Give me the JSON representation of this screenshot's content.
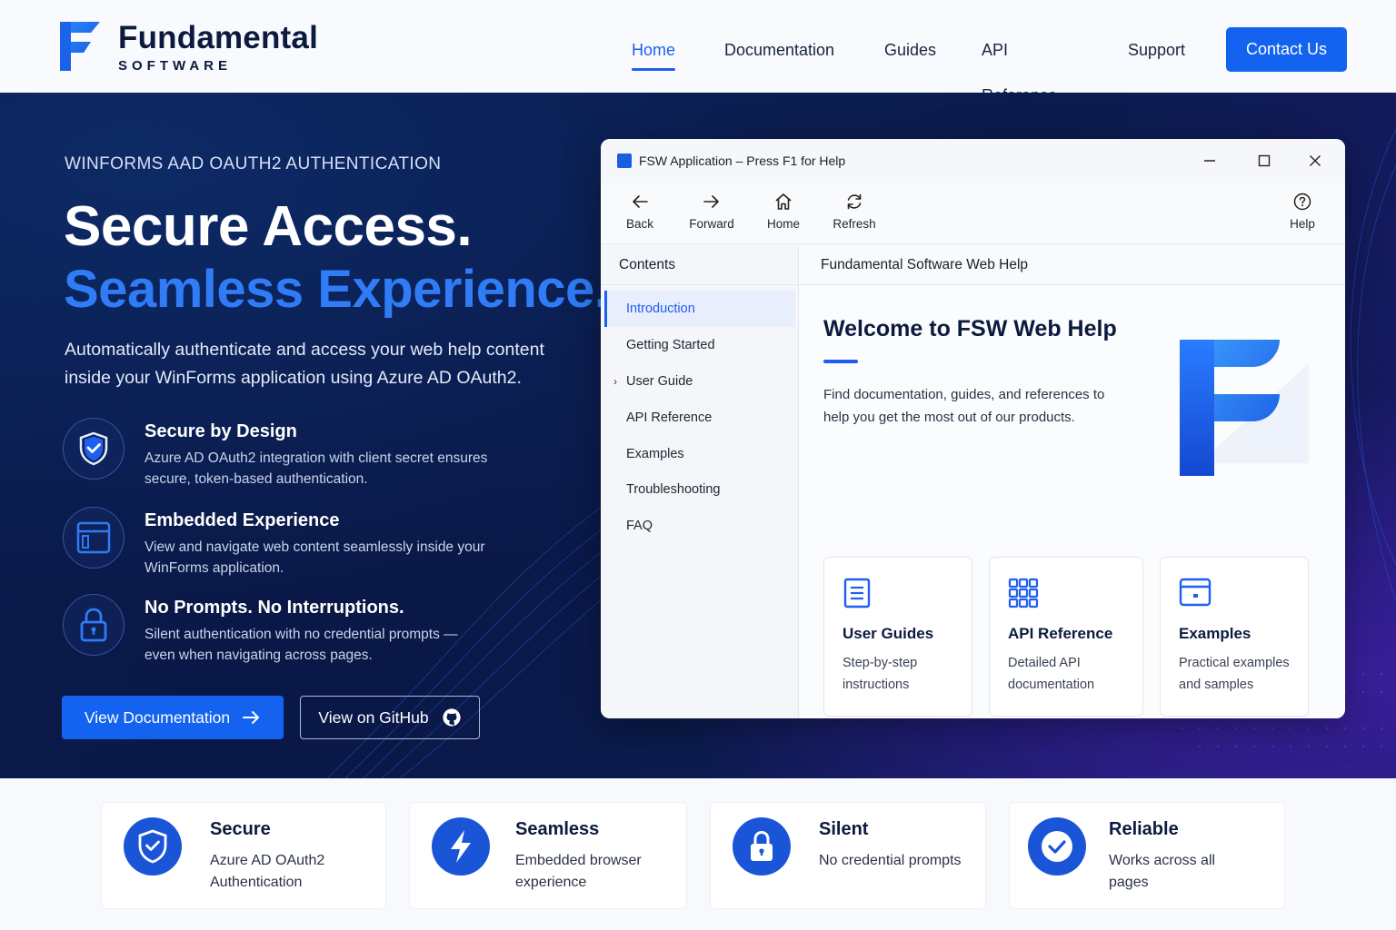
{
  "brand": {
    "name": "Fundamental",
    "sub": "SOFTWARE"
  },
  "nav": {
    "items": [
      "Home",
      "Documentation",
      "Guides",
      "API Reference",
      "Support"
    ],
    "active": "Home",
    "contact": "Contact Us"
  },
  "hero": {
    "eyebrow": "WINFORMS AAD OAUTH2 AUTHENTICATION",
    "title_line1": "Secure Access.",
    "title_line2": "Seamless Experience.",
    "lead": "Automatically authenticate and access your web help content inside your WinForms application using Azure AD OAuth2.",
    "features": [
      {
        "icon": "shield-check-icon",
        "title": "Secure by Design",
        "desc": "Azure AD OAuth2 integration with client secret ensures secure, token-based authentication."
      },
      {
        "icon": "browser-window-icon",
        "title": "Embedded Experience",
        "desc": "View and navigate web content seamlessly inside your WinForms application."
      },
      {
        "icon": "lock-icon",
        "title": "No Prompts. No Interruptions.",
        "desc": "Silent authentication with no credential prompts — even when navigating across pages."
      }
    ],
    "btn_docs": "View Documentation",
    "btn_github": "View on GitHub"
  },
  "app": {
    "title": "FSW Application – Press F1 for Help",
    "toolbar": {
      "back": "Back",
      "forward": "Forward",
      "home": "Home",
      "refresh": "Refresh",
      "help": "Help"
    },
    "sidebar": {
      "header": "Contents",
      "items": [
        "Introduction",
        "Getting Started",
        "User Guide",
        "API Reference",
        "Examples",
        "Troubleshooting",
        "FAQ"
      ],
      "active": "Introduction"
    },
    "content": {
      "header": "Fundamental Software Web Help",
      "welcome": "Welcome to FSW Web Help",
      "text": "Find documentation, guides, and references to help you get the most out of our products.",
      "cards": [
        {
          "icon": "document-icon",
          "title": "User Guides",
          "desc": "Step-by-step instructions"
        },
        {
          "icon": "code-blocks-icon",
          "title": "API Reference",
          "desc": "Detailed API documentation"
        },
        {
          "icon": "window-icon",
          "title": "Examples",
          "desc": "Practical examples and samples"
        }
      ]
    }
  },
  "bottom": [
    {
      "icon": "shield-check-icon",
      "title": "Secure",
      "desc": "Azure AD OAuth2 Authentication"
    },
    {
      "icon": "lightning-icon",
      "title": "Seamless",
      "desc": "Embedded browser experience"
    },
    {
      "icon": "lock-icon",
      "title": "Silent",
      "desc": "No credential prompts"
    },
    {
      "icon": "check-circle-icon",
      "title": "Reliable",
      "desc": "Works across all pages"
    }
  ],
  "colors": {
    "accent": "#1463f0",
    "hero_bg": "#0a1a4a",
    "accent_text": "#2f7cf6"
  }
}
